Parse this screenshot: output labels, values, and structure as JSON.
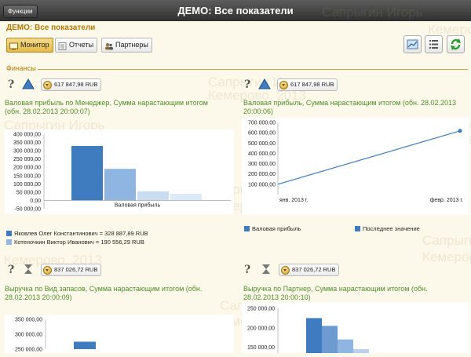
{
  "header": {
    "functions_label": "Функции",
    "title": "ДЕМО: Все показатели"
  },
  "subtitle": "ДЕМО: Все показатели",
  "toolbar": {
    "monitor": "Монитор",
    "reports": "Отчеты",
    "partners": "Партнеры"
  },
  "section": "Финансы",
  "watermark": {
    "name": "Сапрыгин Игорь",
    "city": "Кемерово, 2013"
  },
  "panels": [
    {
      "badge": "617 847,98 RUB",
      "title": "Валовая прибыль по Менеджер, Сумма нарастающим итогом (обн. 28.02.2013 20:00:07)"
    },
    {
      "badge": "617 847,98 RUB",
      "title": "Валовая прибыль, Сумма нарастающим итогом (обн. 28.02.2013 20:00:06)"
    },
    {
      "badge": "837 026,72 RUB",
      "title": "Выручка по Вид запасов, Сумма нарастающим итогом (обн. 28.02.2013 20:00:09)"
    },
    {
      "badge": "837 026,72 RUB",
      "title": "Выручка по Партнер, Сумма нарастающим итогом (обн. 28.02.2013 20:00:10)"
    }
  ],
  "chart_data": [
    {
      "type": "bar",
      "categories": [
        "Валовая прибыль"
      ],
      "series": [
        {
          "name": "Яковлев Олег Константинович = 328 887,89 RUB",
          "values": [
            328887.89
          ]
        },
        {
          "name": "Котеночкин Виктор Иванович = 190 556,29 RUB",
          "values": [
            190556.29
          ]
        },
        {
          "values": [
            55000
          ]
        },
        {
          "values": [
            40000
          ]
        }
      ],
      "ylim": [
        -50000,
        400000
      ],
      "yticks": [
        "400 000,00",
        "350 000,00",
        "300 000,00",
        "250 000,00",
        "200 000,00",
        "150 000,00",
        "100 000,00",
        "50 000,00",
        "0,00",
        "-50 000,00"
      ],
      "colors": [
        "#3f7cbf",
        "#8fb6e0",
        "#c9dcf0",
        "#dce9f6"
      ]
    },
    {
      "type": "line",
      "x": [
        "янв. 2013 г.",
        "февр. 2013 г."
      ],
      "series": [
        {
          "name": "Валовая прибыль",
          "values": [
            100000,
            617847.98
          ]
        }
      ],
      "legend": [
        "Валовая прибыль",
        "Последнее значение"
      ],
      "ylim": [
        0,
        700000
      ],
      "yticks": [
        "700 000,00",
        "600 000,00",
        "500 000,00",
        "400 000,00",
        "300 000,00",
        "200 000,00",
        "100 000,00"
      ],
      "colors": [
        "#3f7cbf",
        "#3f7cbf"
      ]
    },
    {
      "type": "bar",
      "yticks": [
        "350 000,00",
        "300 000,00",
        "250 000,00"
      ],
      "ylim": [
        250000,
        350000
      ],
      "series": [
        {
          "values": [
            275000
          ]
        }
      ],
      "colors": [
        "#3f7cbf"
      ]
    },
    {
      "type": "bar",
      "yticks": [
        "250 000,00",
        "200 000,00",
        "150 000,00"
      ],
      "ylim": [
        125000,
        250000
      ],
      "series": [
        {
          "values": [
            225000
          ]
        },
        {
          "values": [
            205000
          ]
        },
        {
          "values": [
            170000
          ]
        },
        {
          "values": [
            145000
          ]
        }
      ],
      "colors": [
        "#3f7cbf",
        "#6d9bd1",
        "#8fb6e0",
        "#b9d1ec"
      ]
    }
  ]
}
